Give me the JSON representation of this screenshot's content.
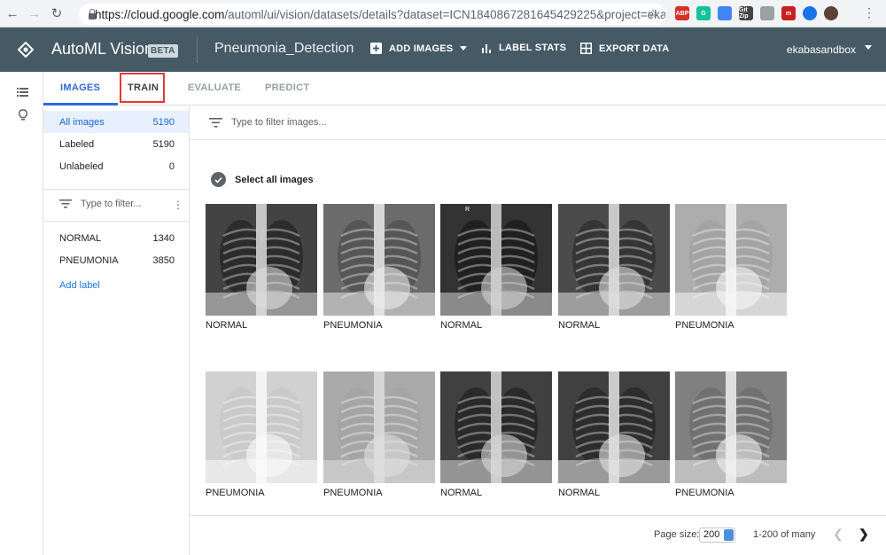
{
  "browser": {
    "url_host": "https://cloud.google.com",
    "url_path": "/automl/ui/vision/datasets/details?dataset=ICN1840867281645429225&project=ekabasa...",
    "extensions": [
      {
        "name": "adblock",
        "text": "ABP",
        "color": "#d93025"
      },
      {
        "name": "grammarly",
        "text": "G",
        "color": "#15c39a"
      },
      {
        "name": "extension-blue",
        "text": "",
        "color": "#4285f4"
      },
      {
        "name": "gitzip",
        "text": "Git Zip",
        "color": "#444444"
      },
      {
        "name": "image-ext",
        "text": "",
        "color": "#9aa0a6"
      },
      {
        "name": "m-ext",
        "text": "m",
        "color": "#c5221f"
      },
      {
        "name": "circle-ext",
        "text": "",
        "color": "#1a73e8"
      },
      {
        "name": "profile-avatar",
        "text": "",
        "color": "#5d4037"
      }
    ]
  },
  "header": {
    "app_title": "AutoML Vision",
    "beta": "BETA",
    "dataset_name": "Pneumonia_Detection",
    "add_images": "ADD IMAGES",
    "label_stats": "LABEL STATS",
    "export_data": "EXPORT DATA",
    "account": "ekabasandbox",
    "color": "#455a64"
  },
  "tabs": [
    {
      "label": "IMAGES",
      "active": true
    },
    {
      "label": "TRAIN",
      "active": false
    },
    {
      "label": "EVALUATE",
      "active": false
    },
    {
      "label": "PREDICT",
      "active": false
    }
  ],
  "sidebar": {
    "filters": [
      {
        "label": "All images",
        "count": "5190"
      },
      {
        "label": "Labeled",
        "count": "5190"
      },
      {
        "label": "Unlabeled",
        "count": "0"
      }
    ],
    "filter_placeholder": "Type to filter...",
    "labels": [
      {
        "label": "NORMAL",
        "count": "1340"
      },
      {
        "label": "PNEUMONIA",
        "count": "3850"
      }
    ],
    "add_label": "Add label"
  },
  "main": {
    "filter_placeholder": "Type to filter images...",
    "select_all": "Select all images",
    "images": [
      {
        "label": "NORMAL"
      },
      {
        "label": "PNEUMONIA"
      },
      {
        "label": "NORMAL"
      },
      {
        "label": "NORMAL"
      },
      {
        "label": "PNEUMONIA"
      },
      {
        "label": "PNEUMONIA"
      },
      {
        "label": "PNEUMONIA"
      },
      {
        "label": "NORMAL"
      },
      {
        "label": "NORMAL"
      },
      {
        "label": "PNEUMONIA"
      }
    ],
    "xray_marker": "R"
  },
  "footer": {
    "page_size_label": "Page size:",
    "page_size_value": "200",
    "page_range": "1-200 of many"
  }
}
